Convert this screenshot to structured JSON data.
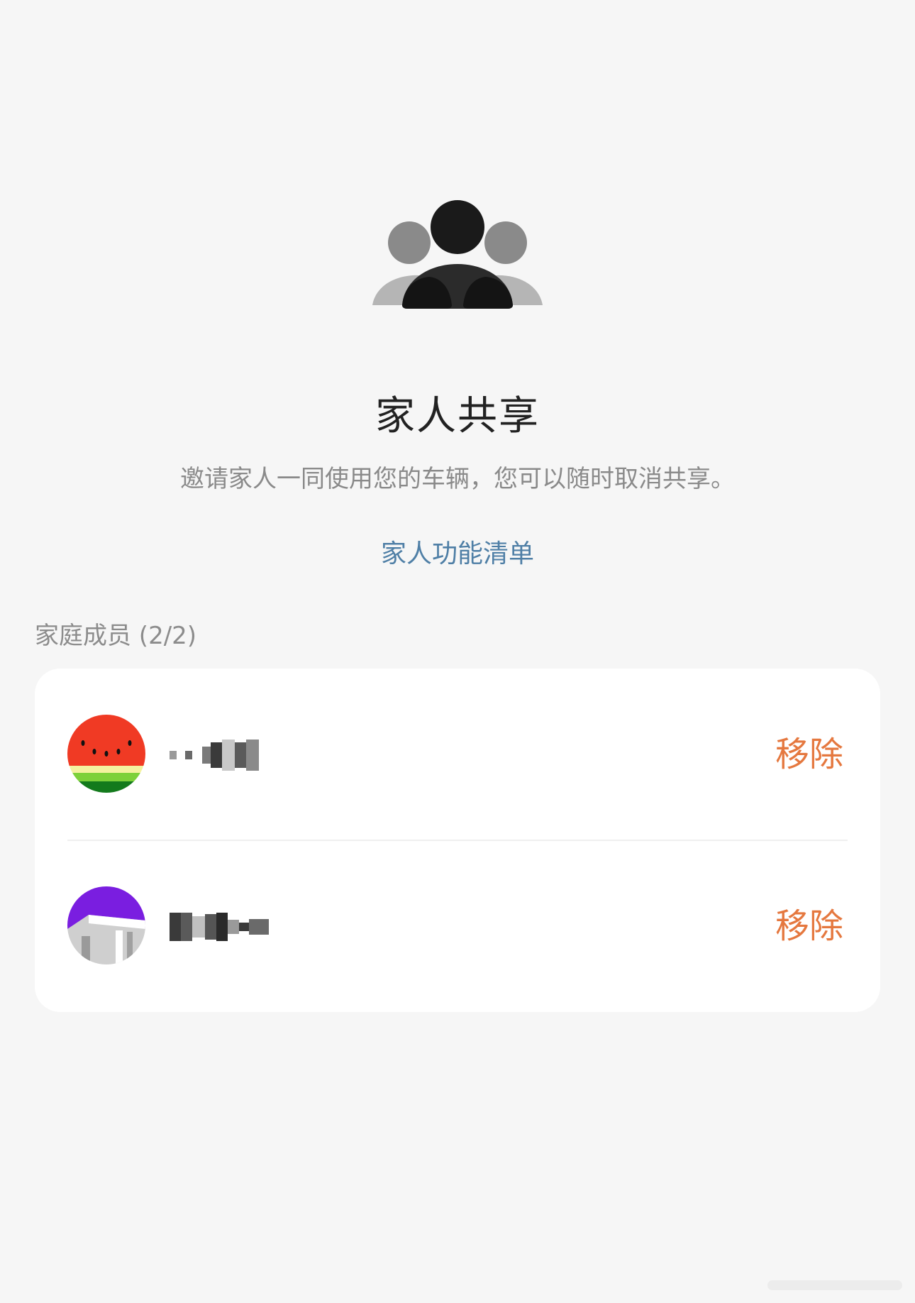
{
  "header": {
    "icon": "family-group-icon",
    "title": "家人共享",
    "subtitle": "邀请家人一同使用您的车辆，您可以随时取消共享。",
    "feature_link": "家人功能清单"
  },
  "members_section": {
    "label": "家庭成员 (2/2)",
    "members": [
      {
        "avatar": "watermelon-avatar",
        "name_obscured": true,
        "remove_label": "移除"
      },
      {
        "avatar": "purple-building-avatar",
        "name_obscured": true,
        "remove_label": "移除"
      }
    ]
  },
  "colors": {
    "background": "#f6f6f6",
    "card": "#ffffff",
    "title": "#222222",
    "subtitle": "#8a8a8a",
    "link": "#4f7fa6",
    "remove": "#e5783f"
  }
}
